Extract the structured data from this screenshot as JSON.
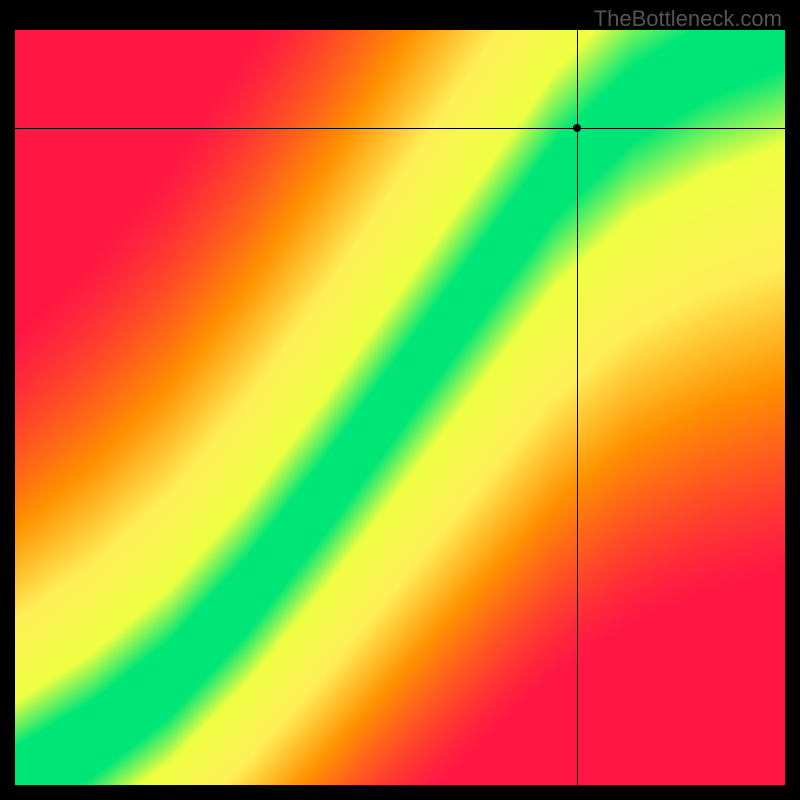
{
  "watermark": "TheBottleneck.com",
  "chart_data": {
    "type": "heatmap",
    "title": "",
    "xlabel": "",
    "ylabel": "",
    "xlim": [
      0,
      1
    ],
    "ylim": [
      0,
      1
    ],
    "marker": {
      "x": 0.73,
      "y": 0.87
    },
    "crosshair": {
      "x": 0.73,
      "y": 0.87
    },
    "ideal_curve_description": "diagonal ridge from bottom-left to top-right with slight S-curve, green along ridge fading through yellow/orange to red at corners",
    "colorscale": [
      {
        "t": 0.0,
        "color": "#ff1744"
      },
      {
        "t": 0.35,
        "color": "#ff9100"
      },
      {
        "t": 0.6,
        "color": "#ffee58"
      },
      {
        "t": 0.85,
        "color": "#eeff41"
      },
      {
        "t": 1.0,
        "color": "#00e676"
      }
    ],
    "ridge_points": [
      {
        "x": 0.0,
        "y": 0.0
      },
      {
        "x": 0.1,
        "y": 0.06
      },
      {
        "x": 0.2,
        "y": 0.14
      },
      {
        "x": 0.3,
        "y": 0.25
      },
      {
        "x": 0.4,
        "y": 0.38
      },
      {
        "x": 0.5,
        "y": 0.52
      },
      {
        "x": 0.6,
        "y": 0.66
      },
      {
        "x": 0.7,
        "y": 0.8
      },
      {
        "x": 0.8,
        "y": 0.9
      },
      {
        "x": 0.9,
        "y": 0.96
      },
      {
        "x": 1.0,
        "y": 1.0
      }
    ],
    "ridge_halfwidth": 0.05
  }
}
